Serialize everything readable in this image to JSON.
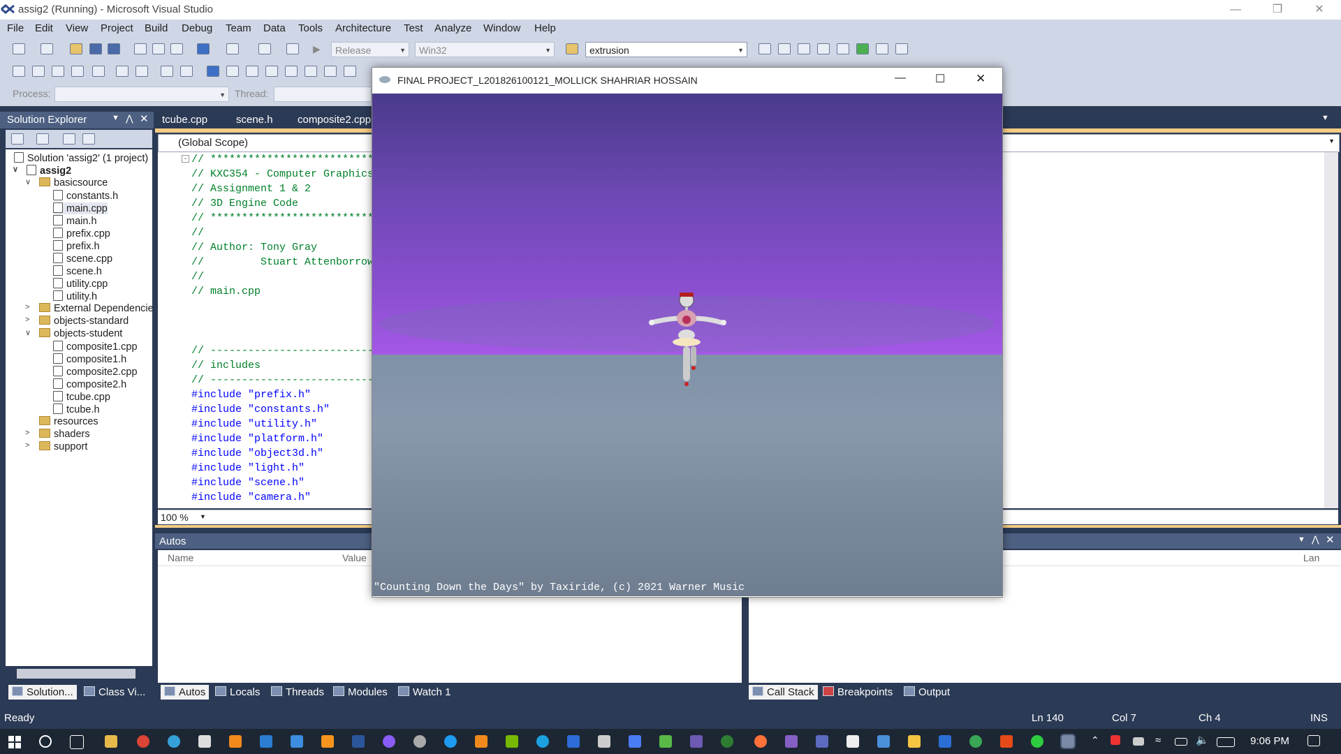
{
  "window": {
    "title": "assig2 (Running) - Microsoft Visual Studio"
  },
  "menu": [
    "File",
    "Edit",
    "View",
    "Project",
    "Build",
    "Debug",
    "Team",
    "Data",
    "Tools",
    "Architecture",
    "Test",
    "Analyze",
    "Window",
    "Help"
  ],
  "toolbar": {
    "config": "Release",
    "platform": "Win32",
    "find": "extrusion",
    "process_label": "Process:",
    "thread_label": "Thread:"
  },
  "solution_explorer": {
    "title": "Solution Explorer",
    "items": [
      {
        "label": "Solution 'assig2' (1 project)",
        "type": "solution"
      },
      {
        "label": "assig2",
        "type": "project"
      },
      {
        "label": "basicsource",
        "type": "folder"
      },
      {
        "label": "constants.h",
        "type": "file"
      },
      {
        "label": "main.cpp",
        "type": "file"
      },
      {
        "label": "main.h",
        "type": "file"
      },
      {
        "label": "prefix.cpp",
        "type": "file"
      },
      {
        "label": "prefix.h",
        "type": "file"
      },
      {
        "label": "scene.cpp",
        "type": "file"
      },
      {
        "label": "scene.h",
        "type": "file"
      },
      {
        "label": "utility.cpp",
        "type": "file"
      },
      {
        "label": "utility.h",
        "type": "file"
      },
      {
        "label": "External Dependencies",
        "type": "folder"
      },
      {
        "label": "objects-standard",
        "type": "folder"
      },
      {
        "label": "objects-student",
        "type": "folder"
      },
      {
        "label": "composite1.cpp",
        "type": "file"
      },
      {
        "label": "composite1.h",
        "type": "file"
      },
      {
        "label": "composite2.cpp",
        "type": "file"
      },
      {
        "label": "composite2.h",
        "type": "file"
      },
      {
        "label": "tcube.cpp",
        "type": "file"
      },
      {
        "label": "tcube.h",
        "type": "file"
      },
      {
        "label": "resources",
        "type": "folder"
      },
      {
        "label": "shaders",
        "type": "folder"
      },
      {
        "label": "support",
        "type": "folder"
      }
    ],
    "bottom_tabs": [
      "Solution...",
      "Class Vi..."
    ]
  },
  "editor": {
    "tabs": [
      "tcube.cpp",
      "scene.h",
      "composite2.cpp"
    ],
    "scope": "(Global Scope)",
    "zoom": "100 %",
    "lines": [
      "// ***************************",
      "// KXC354 - Computer Graphics",
      "// Assignment 1 & 2",
      "// 3D Engine Code",
      "// ***************************",
      "//",
      "// Author: Tony Gray",
      "//         Stuart Attenborrow",
      "//",
      "// main.cpp",
      "",
      "",
      "",
      "// ---------------------------",
      "// includes",
      "// ---------------------------",
      "#include \"prefix.h\"",
      "#include \"constants.h\"",
      "#include \"utility.h\"",
      "#include \"platform.h\"",
      "#include \"object3d.h\"",
      "#include \"light.h\"",
      "#include \"scene.h\"",
      "#include \"camera.h\""
    ]
  },
  "autos": {
    "title": "Autos",
    "columns": [
      "Name",
      "Value"
    ],
    "right_column": "Lan",
    "bottom_tabs": [
      "Autos",
      "Locals",
      "Threads",
      "Modules",
      "Watch 1"
    ]
  },
  "right_panel_tabs": [
    "Call Stack",
    "Breakpoints",
    "Output"
  ],
  "status": {
    "ready": "Ready",
    "ln": "Ln 140",
    "col": "Col 7",
    "ch": "Ch 4",
    "ins": "INS"
  },
  "gl_window": {
    "title": "FINAL PROJECT_L201826100121_MOLLICK SHAHRIAR HOSSAIN",
    "caption": "\"Counting Down the Days\" by Taxiride, (c) 2021 Warner Music"
  },
  "taskbar": {
    "time": "9:06 PM"
  },
  "colors": {
    "vs_dark": "#2b3a55",
    "vs_panel": "#4d6082",
    "accent_yellow": "#f5cc84",
    "sky": "#8a4fd0",
    "ground": "#7e92a8"
  }
}
